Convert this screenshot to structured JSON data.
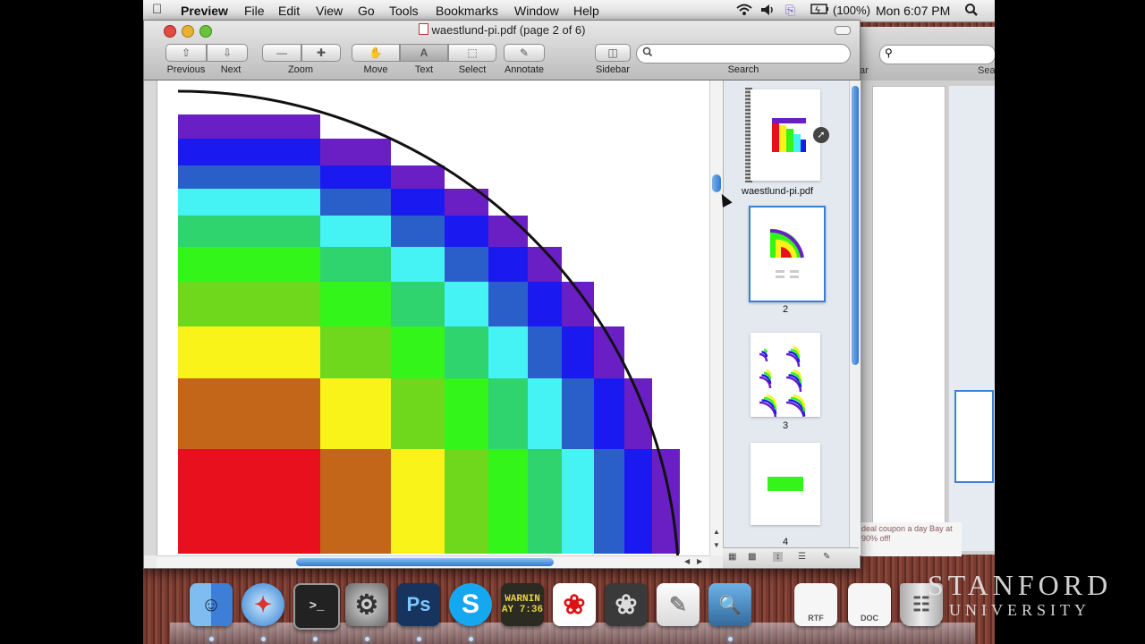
{
  "menubar": {
    "app": "Preview",
    "items": [
      "File",
      "Edit",
      "View",
      "Go",
      "Tools",
      "Bookmarks",
      "Window",
      "Help"
    ],
    "battery": "(100%)",
    "clock": "Mon 6:07 PM"
  },
  "window": {
    "title": "waestlund-pi.pdf (page 2 of 6)",
    "toolbar": {
      "previous": "Previous",
      "next": "Next",
      "zoom": "Zoom",
      "move": "Move",
      "text": "Text",
      "select": "Select",
      "annotate": "Annotate",
      "sidebar": "Sidebar",
      "search_label": "Search",
      "search_value": ""
    }
  },
  "sidebar": {
    "file_name": "waestlund-pi.pdf",
    "pages": [
      "2",
      "3",
      "4"
    ],
    "selected_page": "2"
  },
  "back_window": {
    "search_label": "Search",
    "partial_label": "ar",
    "ad_text": "deal coupon a day Bay at 90% off!"
  },
  "dock": {
    "items": [
      "finder-icon",
      "safari-icon",
      "terminal-icon",
      "system-preferences-icon",
      "photoshop-icon",
      "skype-icon",
      "console-icon",
      "acrobat-icon",
      "acrobat-pro-icon",
      "textedit-icon",
      "preview-icon",
      "rtf-doc-icon",
      "doc-icon",
      "trash-icon"
    ],
    "ps_label": "Ps",
    "console_label": "WARNIN",
    "console_time": "AY 7:36",
    "rtf_label": "RTF",
    "doc_label": "DOC"
  },
  "watermark": {
    "line1": "STANFORD",
    "line2": "UNIVERSITY"
  },
  "colors": {
    "purple": "#6a1fc4",
    "blue": "#1a1af0",
    "mid_blue": "#2a5fc9",
    "cyan": "#45f3f5",
    "teal": "#2fd46e",
    "green": "#33f51a",
    "lime": "#6fd81c",
    "yellow": "#f9f31a",
    "orange": "#c4661a",
    "red": "#e8101c"
  }
}
